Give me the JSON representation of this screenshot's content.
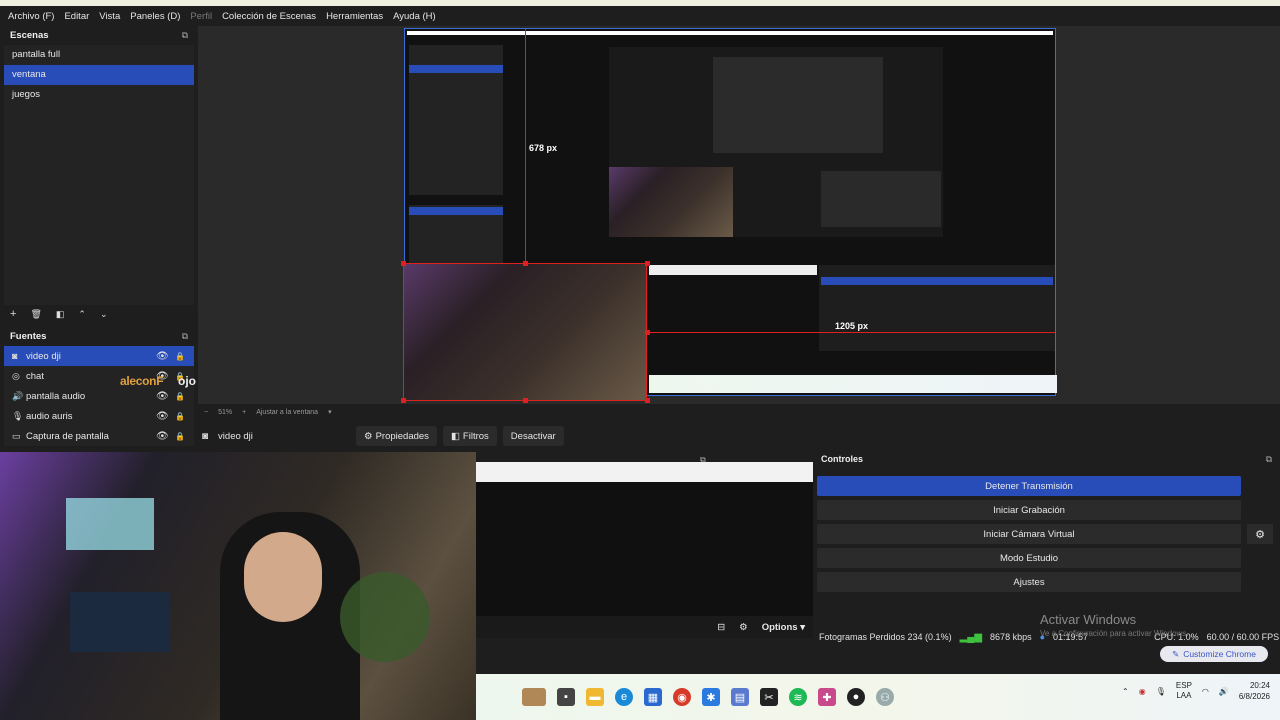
{
  "menu": [
    "Archivo (F)",
    "Editar",
    "Vista",
    "Paneles (D)",
    "Perfil",
    "Colección de Escenas",
    "Herramientas",
    "Ayuda (H)"
  ],
  "menu_disabled": [
    "Perfil"
  ],
  "scenes": {
    "title": "Escenas",
    "items": [
      "pantalla full",
      "ventana",
      "juegos"
    ],
    "selected": "ventana"
  },
  "sources": {
    "title": "Fuentes",
    "items": [
      {
        "label": "video dji",
        "icon": "camera-icon"
      },
      {
        "label": "chat",
        "icon": "globe-icon"
      },
      {
        "label": "pantalla audio",
        "icon": "speaker-icon"
      },
      {
        "label": "audio auris",
        "icon": "microphone-icon"
      },
      {
        "label": "Captura de pantalla",
        "icon": "monitor-icon"
      }
    ],
    "selected": "video dji",
    "overlay_text_1": "aleconF",
    "overlay_text_2": "ojo"
  },
  "preview": {
    "measure_vertical": "678 px",
    "measure_horizontal": "1205 px",
    "zoom": "51%",
    "zoom_fit": "Ajustar a la ventana"
  },
  "context_bar": {
    "source_name": "video dji",
    "properties": "Propiedades",
    "filters": "Filtros",
    "deactivate": "Desactivar"
  },
  "mixer": {
    "options": "Options"
  },
  "controls": {
    "title": "Controles",
    "stop_stream": "Detener Transmisión",
    "start_recording": "Iniciar Grabación",
    "start_virtual_cam": "Iniciar Cámara Virtual",
    "studio_mode": "Modo Estudio",
    "settings": "Ajustes"
  },
  "status": {
    "dropped_frames": "Fotogramas Perdidos 234 (0.1%)",
    "bitrate": "8678 kbps",
    "stream_time": "01:19:57",
    "cpu": "CPU: 1.0%",
    "fps": "60.00 / 60.00 FPS"
  },
  "watermark": {
    "line1": "Activar Windows",
    "line2": "Ve a Configuración para activar Windows."
  },
  "chrome_button": "Customize Chrome",
  "taskbar": {
    "lang_top": "ESP",
    "lang_bottom": "LAA",
    "time": "20:24",
    "date": "6/8/2026"
  },
  "colors": {
    "accent": "#284cb8",
    "highlight_red": "#e02020"
  }
}
